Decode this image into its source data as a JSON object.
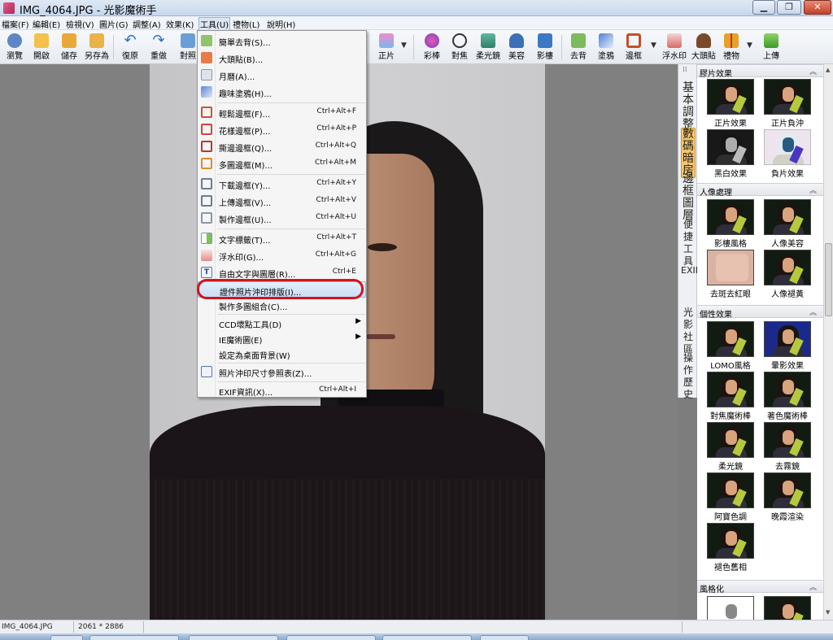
{
  "window": {
    "title": "IMG_4064.JPG - 光影魔術手",
    "minimize": "▁",
    "maximize": "❐",
    "close": "✕"
  },
  "menubar": [
    "檔案(F)",
    "編輯(E)",
    "檢視(V)",
    "圖片(G)",
    "調整(A)",
    "效果(K)",
    "工具(U)",
    "禮物(L)",
    "說明(H)"
  ],
  "toolbar": {
    "left": [
      "瀏覽",
      "開啟",
      "儲存",
      "另存為",
      "復原",
      "重做",
      "對照"
    ],
    "right": [
      "正片",
      "彩棒",
      "對焦",
      "柔光鏡",
      "美容",
      "影樓",
      "去背",
      "塗鴉",
      "邊框",
      "浮水印",
      "大頭貼",
      "禮物",
      "上傳"
    ]
  },
  "tools_menu": {
    "items": [
      {
        "label": "簡單去背(S)...",
        "shortcut": ""
      },
      {
        "label": "大頭貼(B)...",
        "shortcut": ""
      },
      {
        "label": "月曆(A)...",
        "shortcut": ""
      },
      {
        "label": "趣味塗鴉(H)...",
        "shortcut": ""
      },
      {
        "label": "輕鬆邊框(F)...",
        "shortcut": "Ctrl+Alt+F"
      },
      {
        "label": "花樣邊框(P)...",
        "shortcut": "Ctrl+Alt+P"
      },
      {
        "label": "撕邊邊框(Q)...",
        "shortcut": "Ctrl+Alt+Q"
      },
      {
        "label": "多圖邊框(M)...",
        "shortcut": "Ctrl+Alt+M"
      },
      {
        "label": "下載邊框(Y)...",
        "shortcut": "Ctrl+Alt+Y"
      },
      {
        "label": "上傳邊框(V)...",
        "shortcut": "Ctrl+Alt+V"
      },
      {
        "label": "製作邊框(U)...",
        "shortcut": "Ctrl+Alt+U"
      },
      {
        "label": "文字標籤(T)...",
        "shortcut": "Ctrl+Alt+T"
      },
      {
        "label": "浮水印(G)...",
        "shortcut": "Ctrl+Alt+G"
      },
      {
        "label": "自由文字與圖層(R)...",
        "shortcut": "Ctrl+E"
      },
      {
        "label": "證件照片沖印排版(I)...",
        "shortcut": ""
      },
      {
        "label": "製作多圖組合(C)...",
        "shortcut": ""
      },
      {
        "label": "CCD壞點工具(D)",
        "shortcut": ""
      },
      {
        "label": "IE魔術圖(E)",
        "shortcut": ""
      },
      {
        "label": "設定為桌面背景(W)",
        "shortcut": ""
      },
      {
        "label": "照片沖印尺寸參照表(Z)...",
        "shortcut": ""
      },
      {
        "label": "EXIF資訊(X)...",
        "shortcut": "Ctrl+Alt+I"
      }
    ]
  },
  "side_tabs": [
    "基本調整",
    "數碼暗房",
    "邊框圖層",
    "便捷工具",
    "EXIF",
    "光影社區",
    "操作歷史"
  ],
  "panel": {
    "sections": [
      {
        "title": "膠片效果",
        "items": [
          "正片效果",
          "正片負沖",
          "黑白效果",
          "負片效果"
        ]
      },
      {
        "title": "人像處理",
        "items": [
          "影樓風格",
          "人像美容",
          "去斑去紅眼",
          "人像褪黃"
        ]
      },
      {
        "title": "個性效果",
        "items": [
          "LOMO風格",
          "暈影效果",
          "對焦魔術棒",
          "著色魔術棒",
          "柔光鏡",
          "去霧鏡",
          "阿寶色調",
          "晚霞渲染",
          "褪色舊相"
        ]
      },
      {
        "title": "風格化",
        "items": []
      }
    ],
    "collapse_glyph": "︽"
  },
  "statusbar": {
    "filename": "IMG_4064.JPG",
    "dimensions": "2061 * 2886"
  },
  "colors": {
    "highlight_ring": "#d4141c",
    "active_tab": "#f6c66a"
  }
}
